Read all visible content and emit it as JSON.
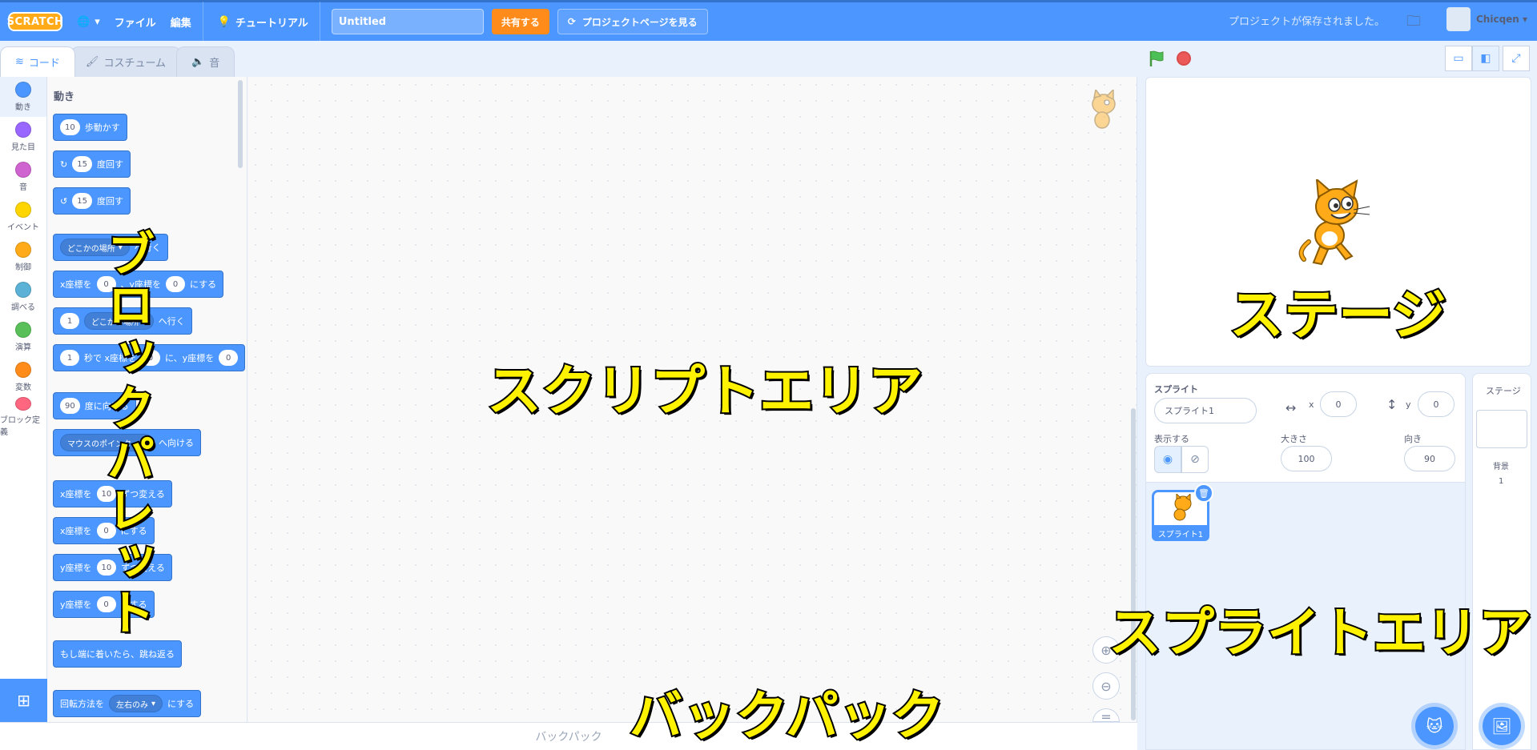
{
  "menubar": {
    "logo": "SCRATCH",
    "language_icon": "globe-icon",
    "file": "ファイル",
    "edit": "編集",
    "tutorial": "チュートリアル",
    "title_value": "Untitled",
    "share": "共有する",
    "project_page": "プロジェクトページを見る",
    "saved_status": "プロジェクトが保存されました。",
    "username": "Chicqen"
  },
  "tabs": [
    {
      "label": "コード",
      "icon": "code-icon"
    },
    {
      "label": "コスチューム",
      "icon": "brush-icon"
    },
    {
      "label": "音",
      "icon": "speaker-icon"
    }
  ],
  "categories": [
    {
      "label": "動き",
      "color": "#4c97ff"
    },
    {
      "label": "見た目",
      "color": "#9966ff"
    },
    {
      "label": "音",
      "color": "#cf63cf"
    },
    {
      "label": "イベント",
      "color": "#ffd500"
    },
    {
      "label": "制御",
      "color": "#ffab19"
    },
    {
      "label": "調べる",
      "color": "#5cb1d6"
    },
    {
      "label": "演算",
      "color": "#59c059"
    },
    {
      "label": "変数",
      "color": "#ff8c1a"
    },
    {
      "label": "ブロック定義",
      "color": "#ff6680"
    }
  ],
  "palette": {
    "heading": "動き",
    "blocks": {
      "move": {
        "value": "10",
        "text": "歩動かす"
      },
      "turn_right": {
        "value": "15",
        "text": "度回す"
      },
      "turn_left": {
        "value": "15",
        "text": "度回す"
      },
      "goto": {
        "dropdown": "どこかの場所",
        "text": "へ行く"
      },
      "goto_xy": {
        "t1": "x座標を",
        "x": "0",
        "t2": "、y座標を",
        "y": "0",
        "t3": "にする"
      },
      "glide_to": {
        "value": "1",
        "dropdown": "どこかの場所",
        "text": "へ行く"
      },
      "glide_xy": {
        "value": "1",
        "t1": "秒で x座標を",
        "x": "0",
        "t2": "に、y座標を",
        "y": "0"
      },
      "point_dir": {
        "value": "90",
        "text": "度に向ける"
      },
      "point_towards": {
        "dropdown": "マウスのポインター",
        "text": "へ向ける"
      },
      "change_x": {
        "t1": "x座標を",
        "value": "10",
        "t2": "ずつ変える"
      },
      "set_x": {
        "t1": "x座標を",
        "value": "0",
        "t2": "にする"
      },
      "change_y": {
        "t1": "y座標を",
        "value": "10",
        "t2": "ずつ変える"
      },
      "set_y": {
        "t1": "y座標を",
        "value": "0",
        "t2": "にする"
      },
      "bounce": {
        "text": "もし端に着いたら、跳ね返る"
      },
      "rotation_style": {
        "t1": "回転方法を",
        "dropdown": "左右のみ",
        "t2": "にする"
      }
    }
  },
  "backpack": {
    "label": "バックパック"
  },
  "sprite_info": {
    "sprite_label": "スプライト",
    "sprite_name": "スプライト1",
    "x_label": "x",
    "x_value": "0",
    "y_label": "y",
    "y_value": "0",
    "show_label": "表示する",
    "size_label": "大きさ",
    "size_value": "100",
    "direction_label": "向き",
    "direction_value": "90"
  },
  "sprite_list": [
    {
      "name": "スプライト1"
    }
  ],
  "stage_pane": {
    "label": "ステージ",
    "backdrops_label": "背景",
    "backdrops_count": "1"
  },
  "annotations": {
    "block_palette": "ブロックパレット",
    "script_area": "スクリプトエリア",
    "stage": "ステージ",
    "sprite_area": "スプライトエリア",
    "backpack": "バックパック"
  },
  "colors": {
    "menubar": "#4c97ff",
    "share_button": "#ff8c1a",
    "motion_block": "#4c97ff",
    "annotation_text": "#fff200"
  }
}
